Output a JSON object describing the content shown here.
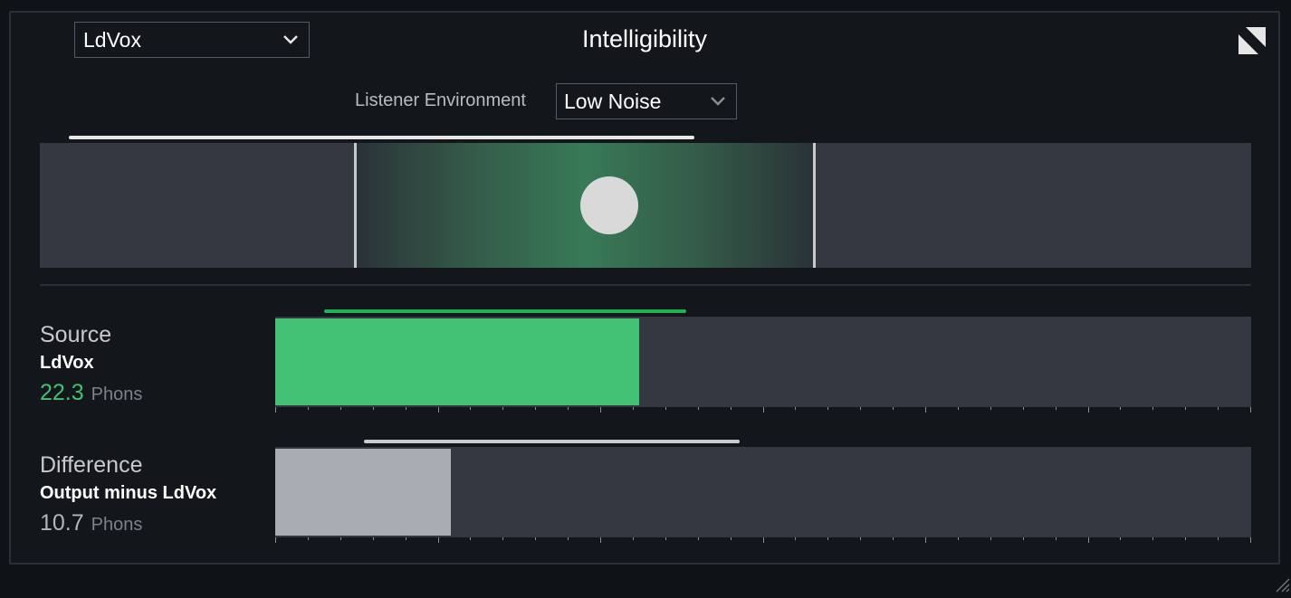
{
  "header": {
    "model_select": "LdVox",
    "title": "Intelligibility"
  },
  "environment": {
    "label": "Listener Environment",
    "value": "Low Noise"
  },
  "position_display": {
    "zone_start": 0.26,
    "zone_end": 0.64,
    "marker": 0.47,
    "range_end": 0.54
  },
  "rows": [
    {
      "title": "Source",
      "subtitle": "LdVox",
      "value": "22.3",
      "unit": "Phons",
      "value_color": "#3fc172",
      "fill_color": "#42c274",
      "fill_fraction": 0.373,
      "range_line_color": "#21b155",
      "range_start": 0.05,
      "range_end": 0.421
    },
    {
      "title": "Difference",
      "subtitle": "Output minus LdVox",
      "value": "10.7",
      "unit": "Phons",
      "value_color": "#b3b7bc",
      "fill_color": "#a9adb3",
      "fill_fraction": 0.18,
      "range_line_color": "#c9cbcf",
      "range_start": 0.091,
      "range_end": 0.476
    }
  ],
  "icons": {
    "dropdown": "chevron-down-icon",
    "expand": "expand-icon",
    "resize": "resize-grip-icon"
  }
}
